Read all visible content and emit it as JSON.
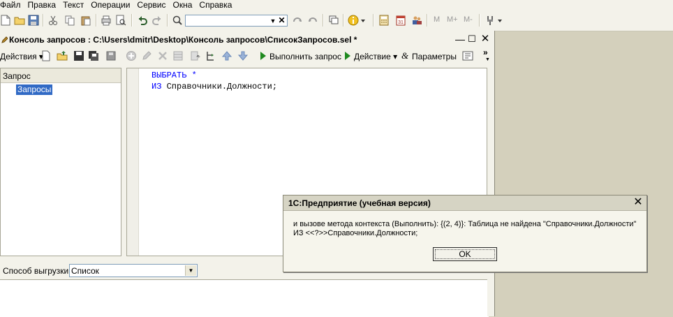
{
  "menu": {
    "items": [
      "Файл",
      "Правка",
      "Текст",
      "Операции",
      "Сервис",
      "Окна",
      "Справка"
    ]
  },
  "toolbar": {
    "search_value": "",
    "m_labels": [
      "M",
      "M+",
      "M-"
    ]
  },
  "console": {
    "title": "Консоль запросов : C:\\Users\\dmitr\\Desktop\\Консоль запросов\\СписокЗапросов.sel *",
    "actions_label": "Действия",
    "run_label": "Выполнить запрос",
    "action_label": "Действие",
    "params_label": "Параметры",
    "tree": {
      "header": "Запрос",
      "items": [
        "Запросы"
      ]
    },
    "editor": {
      "line1_kw": "ВЫБРАТЬ",
      "line1_star": "*",
      "line2_kw": "ИЗ",
      "line2_rest": "Справочники.Должности;"
    },
    "export": {
      "label": "Способ выгрузки:",
      "value": "Список"
    }
  },
  "dialog": {
    "title": "1С:Предприятие (учебная версия)",
    "line1": "и вызове метода контекста (Выполнить): {(2, 4)}: Таблица не найдена \"Справочники.Должности\"",
    "line2": "ИЗ <<?>>Справочники.Должности;",
    "ok_label": "OK"
  },
  "colors": {
    "keyword": "#0000ff",
    "selection": "#316ac5",
    "workspace": "#d4d0bc"
  }
}
